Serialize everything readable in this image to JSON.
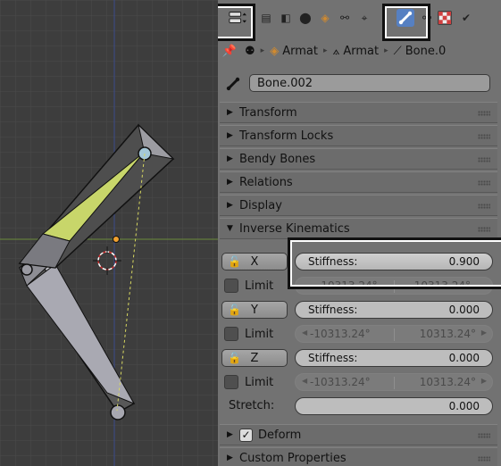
{
  "viewport": {
    "name": "3d-viewport"
  },
  "header": {
    "tabs": [
      "render",
      "render-layers",
      "scene",
      "world",
      "object",
      "constraints",
      "data",
      "bone",
      "bone-constraints",
      "material",
      "texture"
    ],
    "active_tab": "bone"
  },
  "breadcrumb": {
    "items": [
      {
        "icon": "armature-object-icon",
        "label": "Armat"
      },
      {
        "icon": "armature-data-icon",
        "label": "Armat"
      },
      {
        "icon": "bone-icon",
        "label": "Bone.0"
      }
    ]
  },
  "bone_name": {
    "value": "Bone.002"
  },
  "sections": {
    "transform": "Transform",
    "transform_locks": "Transform Locks",
    "bendy_bones": "Bendy Bones",
    "relations": "Relations",
    "display": "Display",
    "inverse_kinematics": "Inverse Kinematics",
    "deform": "Deform",
    "custom_properties": "Custom Properties"
  },
  "ik": {
    "stiffness_label": "Stiffness:",
    "limit_label": "Limit",
    "x": {
      "axis": "X",
      "stiffness": "0.900",
      "limit_min": "-10313.24°",
      "limit_max": "10313.24°"
    },
    "y": {
      "axis": "Y",
      "stiffness": "0.000",
      "limit_min": "-10313.24°",
      "limit_max": "10313.24°"
    },
    "z": {
      "axis": "Z",
      "stiffness": "0.000",
      "limit_min": "-10313.24°",
      "limit_max": "10313.24°"
    },
    "stretch_label": "Stretch:",
    "stretch": "0.000"
  },
  "deform": {
    "checked": "✓"
  },
  "colors": {
    "accent": "#5680c2",
    "panel": "#727272",
    "header": "#6c6c6c",
    "selected_bone": "#c8d66a"
  }
}
